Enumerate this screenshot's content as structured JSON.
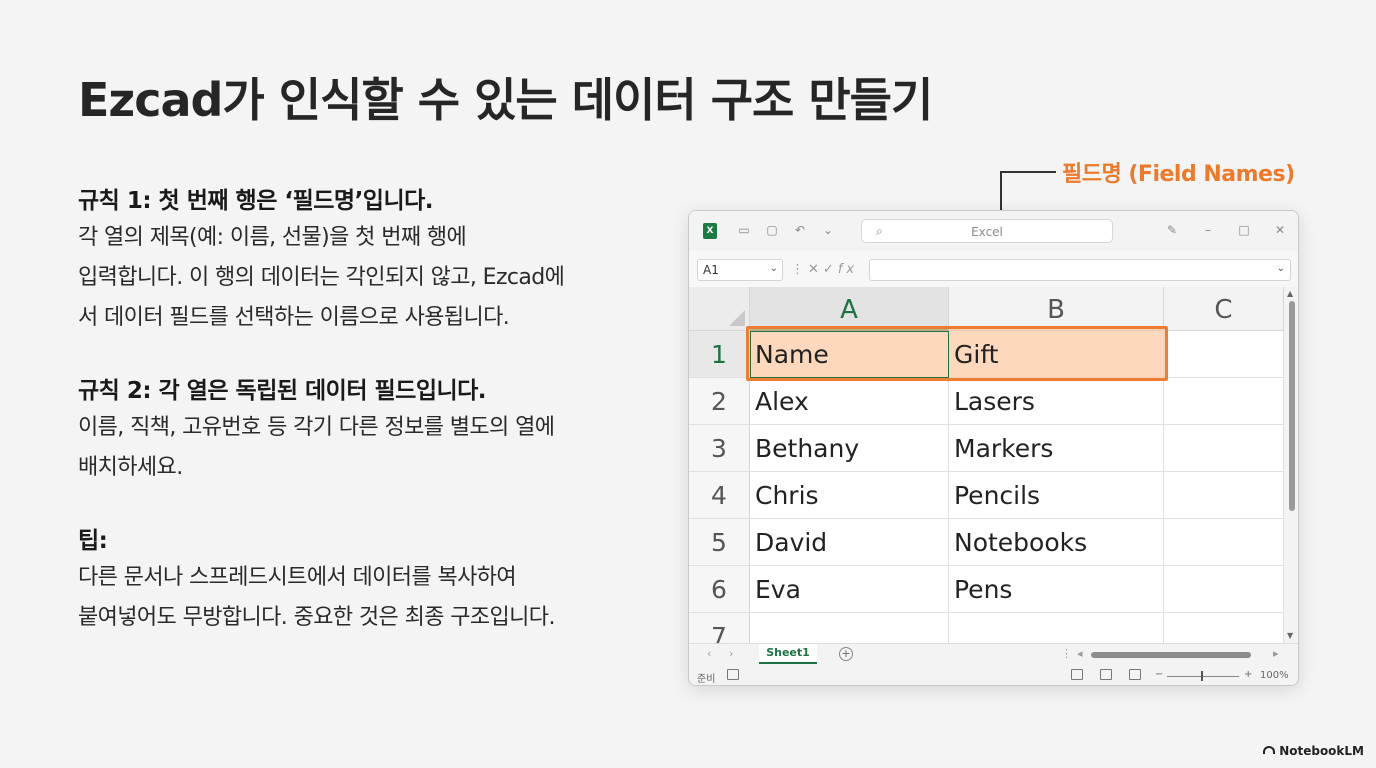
{
  "title": "Ezcad가 인식할 수 있는 데이터 구조 만들기",
  "rules": [
    {
      "heading": "규칙 1: 첫 번째 행은 ‘필드명’입니다.",
      "lines": [
        "각 열의 제목(예: 이름, 선물)을 첫 번째 행에",
        "입력합니다. 이 행의 데이터는 각인되지 않고, Ezcad에",
        "서 데이터 필드를 선택하는 이름으로 사용됩니다."
      ]
    },
    {
      "heading": "규칙 2: 각 열은 독립된 데이터 필드입니다.",
      "lines": [
        "이름, 직책, 고유번호 등 각기 다른 정보를 별도의 열에",
        "배치하세요."
      ]
    },
    {
      "heading": "팁:",
      "lines": [
        "다른 문서나 스프레드시트에서 데이터를 복사하여",
        "붙여넣어도 무방합니다. 중요한 것은 최종 구조입니다."
      ]
    }
  ],
  "callout": {
    "label": "필드명 (Field Names)",
    "color": "#ec7a2c"
  },
  "excel": {
    "search_text": "Excel",
    "name_box": "A1",
    "fx_label": "fx",
    "columns": [
      "A",
      "B",
      "C"
    ],
    "rows": [
      "1",
      "2",
      "3",
      "4",
      "5",
      "6",
      "7"
    ],
    "header_row": [
      "Name",
      "Gift"
    ],
    "data": [
      [
        "Alex",
        "Lasers"
      ],
      [
        "Bethany",
        "Markers"
      ],
      [
        "Chris",
        "Pencils"
      ],
      [
        "David",
        "Notebooks"
      ],
      [
        "Eva",
        "Pens"
      ]
    ],
    "sheet_tab": "Sheet1",
    "status_left": "준비",
    "zoom": "100%",
    "accent": "#1d7244",
    "highlight": "#ee7d32"
  },
  "brand": "NotebookLM"
}
